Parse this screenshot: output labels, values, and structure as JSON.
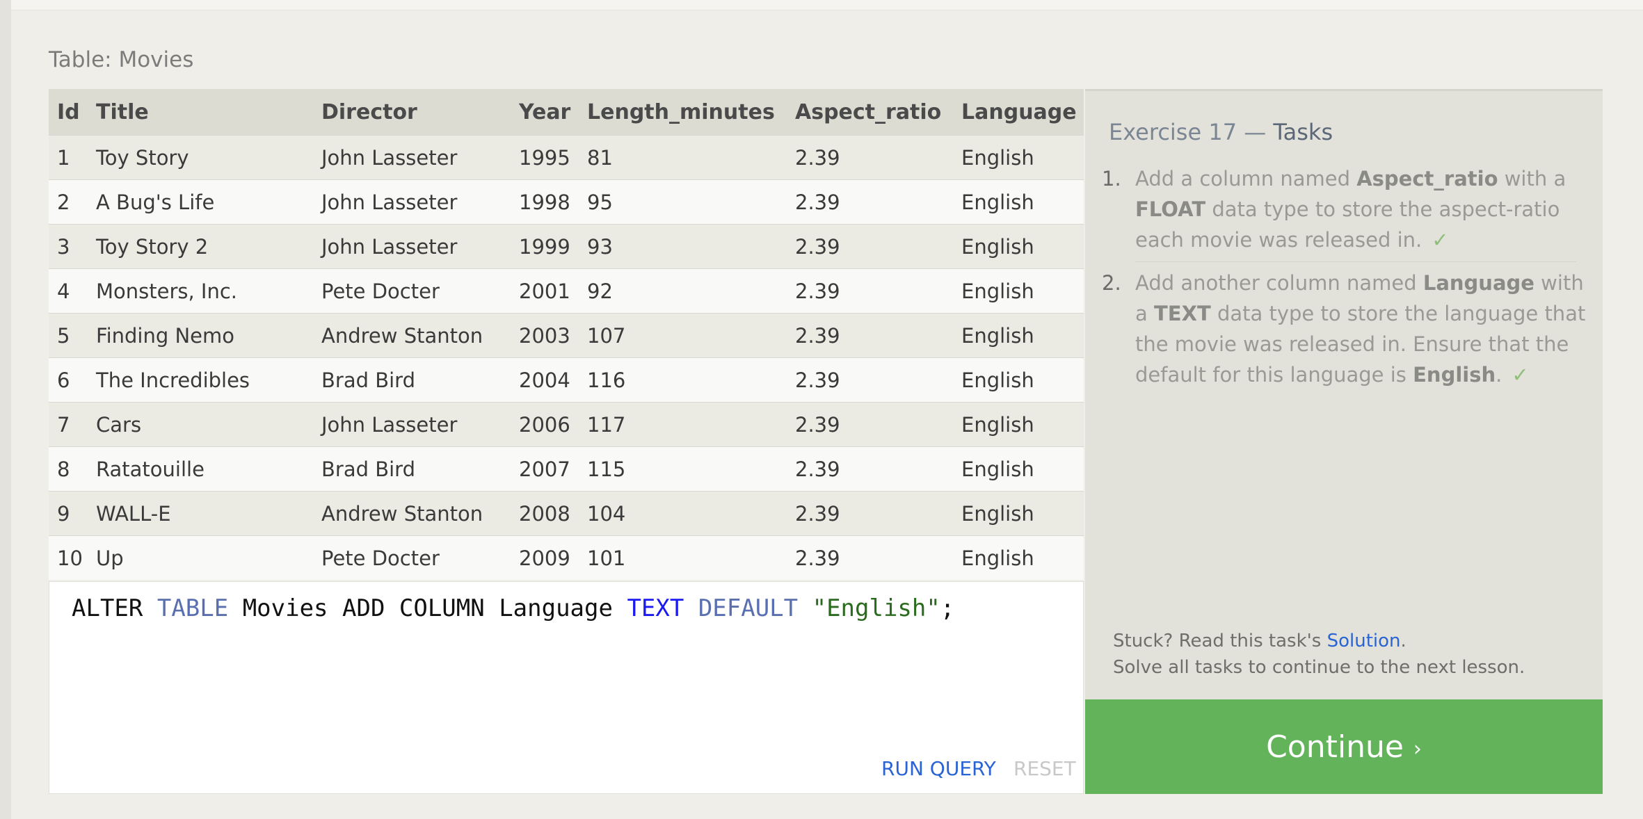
{
  "table_label": "Table: Movies",
  "columns": [
    "Id",
    "Title",
    "Director",
    "Year",
    "Length_minutes",
    "Aspect_ratio",
    "Language"
  ],
  "rows": [
    [
      "1",
      "Toy Story",
      "John Lasseter",
      "1995",
      "81",
      "2.39",
      "English"
    ],
    [
      "2",
      "A Bug's Life",
      "John Lasseter",
      "1998",
      "95",
      "2.39",
      "English"
    ],
    [
      "3",
      "Toy Story 2",
      "John Lasseter",
      "1999",
      "93",
      "2.39",
      "English"
    ],
    [
      "4",
      "Monsters, Inc.",
      "Pete Docter",
      "2001",
      "92",
      "2.39",
      "English"
    ],
    [
      "5",
      "Finding Nemo",
      "Andrew Stanton",
      "2003",
      "107",
      "2.39",
      "English"
    ],
    [
      "6",
      "The Incredibles",
      "Brad Bird",
      "2004",
      "116",
      "2.39",
      "English"
    ],
    [
      "7",
      "Cars",
      "John Lasseter",
      "2006",
      "117",
      "2.39",
      "English"
    ],
    [
      "8",
      "Ratatouille",
      "Brad Bird",
      "2007",
      "115",
      "2.39",
      "English"
    ],
    [
      "9",
      "WALL-E",
      "Andrew Stanton",
      "2008",
      "104",
      "2.39",
      "English"
    ],
    [
      "10",
      "Up",
      "Pete Docter",
      "2009",
      "101",
      "2.39",
      "English"
    ]
  ],
  "editor": {
    "tokens": {
      "alter": "ALTER",
      "table": "TABLE",
      "movies": "Movies",
      "add_column": "ADD COLUMN",
      "language": "Language",
      "text_type": "TEXT",
      "default": "DEFAULT",
      "value": "\"English\"",
      "semicolon": ";"
    },
    "run_label": "RUN QUERY",
    "reset_label": "RESET"
  },
  "exercise": {
    "title_prefix": "Exercise 17 —",
    "title_suffix": "Tasks",
    "tasks": [
      {
        "num": "1.",
        "t1": "Add a column named",
        "b1": "Aspect_ratio",
        "t2": "with a",
        "b2": "FLOAT",
        "t3": "data type to store the aspect-ratio each movie was released in.",
        "check": "✓"
      },
      {
        "num": "2.",
        "t1": "Add another column named",
        "b1": "Language",
        "t2": "with a",
        "b2": "TEXT",
        "t3": "data type to store the language that the movie was released in. Ensure that the default for this language is",
        "b3": "English",
        "t4": ".",
        "check": "✓"
      }
    ],
    "stuck_prefix": "Stuck? Read this task's",
    "solution_link": "Solution",
    "stuck_suffix": ".",
    "solve_all": "Solve all tasks to continue to the next lesson."
  },
  "continue": {
    "label": "Continue",
    "chevron": "›"
  },
  "colors": {
    "continue_bg": "#62b35a",
    "link": "#2a63d4",
    "check": "#8fbf7a"
  }
}
